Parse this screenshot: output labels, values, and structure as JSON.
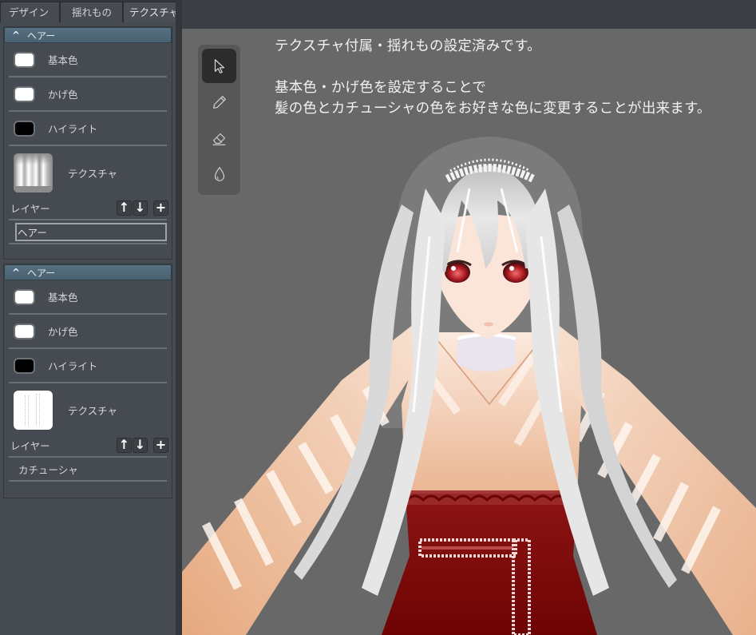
{
  "tabs": [
    {
      "label": "デザイン",
      "active": false
    },
    {
      "label": "揺れもの",
      "active": false
    },
    {
      "label": "テクスチャ",
      "active": true
    }
  ],
  "panels": [
    {
      "title": "ヘアー",
      "collapse_icon": "chevron-up-icon",
      "colors": [
        {
          "label": "基本色",
          "color": "#ffffff"
        },
        {
          "label": "かげ色",
          "color": "#ffffff"
        },
        {
          "label": "ハイライト",
          "color": "#000000"
        }
      ],
      "texture_label": "テクスチャ",
      "layer_label": "レイヤー",
      "layer_buttons": {
        "up": "↑",
        "down": "↓",
        "add": "+"
      },
      "layer_value": "ヘアー"
    },
    {
      "title": "ヘアー",
      "collapse_icon": "chevron-up-icon",
      "colors": [
        {
          "label": "基本色",
          "color": "#ffffff"
        },
        {
          "label": "かげ色",
          "color": "#ffffff"
        },
        {
          "label": "ハイライト",
          "color": "#000000"
        }
      ],
      "texture_label": "テクスチャ",
      "layer_label": "レイヤー",
      "layer_buttons": {
        "up": "↑",
        "down": "↓",
        "add": "+"
      },
      "layer_value": "カチューシャ"
    }
  ],
  "tools": [
    {
      "name": "select-tool",
      "icon": "cursor-arrow-icon",
      "active": true
    },
    {
      "name": "pen-tool",
      "icon": "pencil-icon",
      "active": false
    },
    {
      "name": "eraser-tool",
      "icon": "eraser-icon",
      "active": false
    },
    {
      "name": "fill-tool",
      "icon": "droplet-icon",
      "active": false
    }
  ],
  "caption": {
    "line1": "テクスチャ付属・揺れもの設定済みです。",
    "line2": "基本色・かげ色を設定することで",
    "line3": "髪の色とカチューシャの色をお好きな色に変更することが出来ます。"
  },
  "colors": {
    "sidebar_bg": "#464b51",
    "panel_header": "#557080",
    "viewport_bg": "#686868",
    "hair": "#e8e8e8",
    "skin": "#f3d2bd",
    "dress_red": "#8a1212",
    "eye_red": "#b01c22"
  }
}
